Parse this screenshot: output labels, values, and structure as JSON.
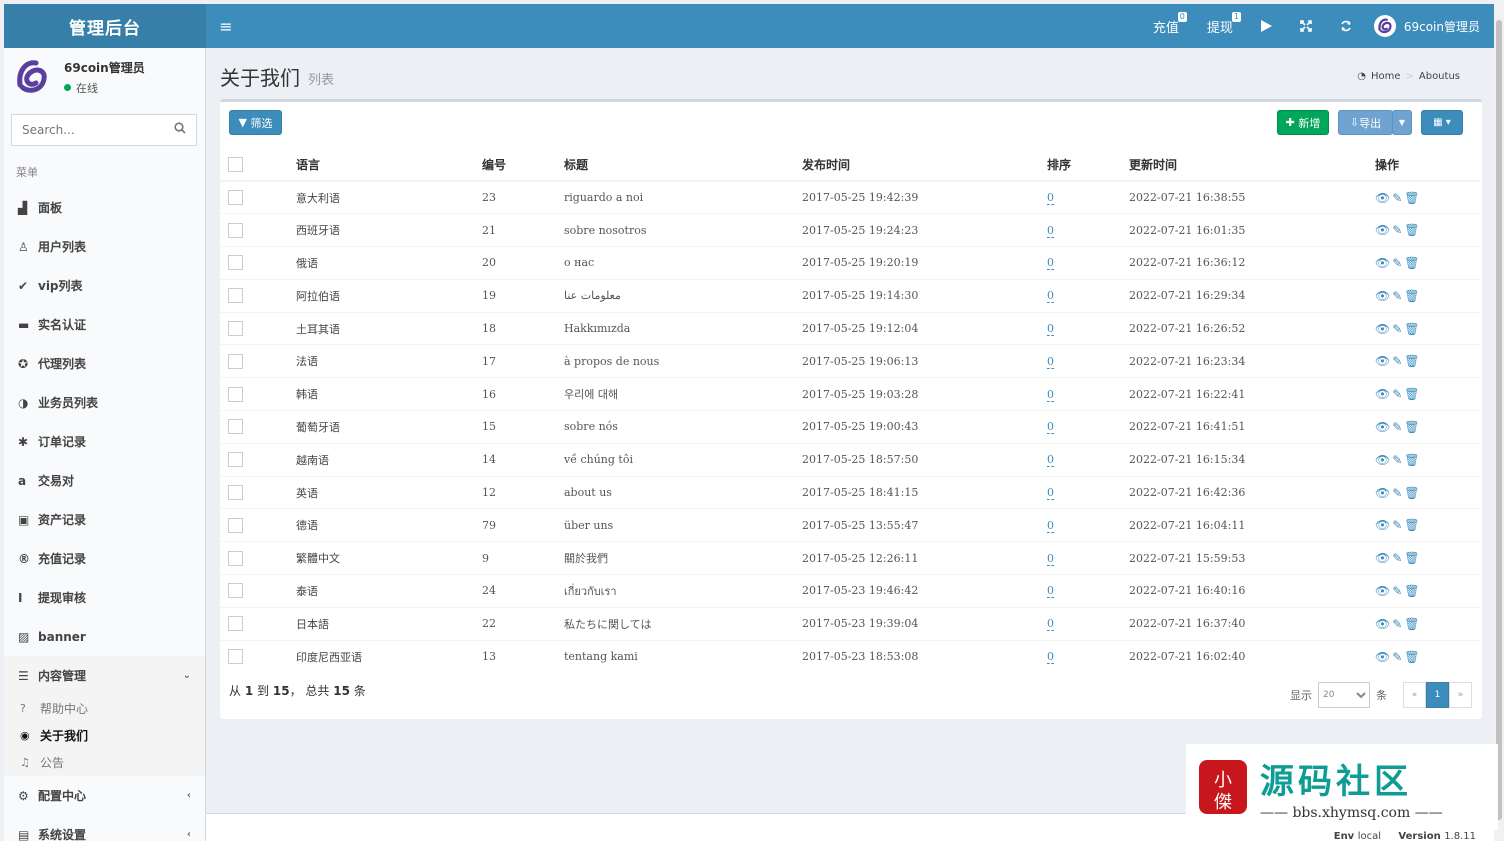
{
  "header": {
    "logo": "管理后台",
    "toggle_icon": "≡",
    "recharge_label": "充值",
    "recharge_badge": "0",
    "withdraw_label": "提现",
    "withdraw_badge": "1",
    "user_name": "69coin管理员"
  },
  "sidebar": {
    "user_name": "69coin管理员",
    "status": "在线",
    "search_placeholder": "Search...",
    "menu_header": "菜单",
    "items": [
      {
        "label": "面板",
        "icon": "▟"
      },
      {
        "label": "用户列表",
        "icon": "♙"
      },
      {
        "label": "vip列表",
        "icon": "✔"
      },
      {
        "label": "实名认证",
        "icon": "▬"
      },
      {
        "label": "代理列表",
        "icon": "✪"
      },
      {
        "label": "业务员列表",
        "icon": "◑"
      },
      {
        "label": "订单记录",
        "icon": "✱"
      },
      {
        "label": "交易对",
        "icon": "a"
      },
      {
        "label": "资产记录",
        "icon": "▣"
      },
      {
        "label": "充值记录",
        "icon": "®"
      },
      {
        "label": "提现审核",
        "icon": "I"
      },
      {
        "label": "banner",
        "icon": "▨"
      }
    ],
    "content_menu": {
      "label": "内容管理",
      "icon": "☰",
      "children": [
        {
          "label": "帮助中心",
          "icon": "?"
        },
        {
          "label": "关于我们",
          "icon": "◉"
        },
        {
          "label": "公告",
          "icon": "♫"
        }
      ]
    },
    "config_menu": {
      "label": "配置中心",
      "icon": "⚙"
    },
    "system_menu": {
      "label": "系统设置",
      "icon": "▤"
    }
  },
  "content": {
    "title": "关于我们",
    "subtitle": "列表",
    "breadcrumb_home": "Home",
    "breadcrumb_current": "Aboutus"
  },
  "toolbar": {
    "filter_label": "筛选",
    "new_label": "新增",
    "export_label": "导出"
  },
  "table": {
    "columns": [
      "语言",
      "编号",
      "标题",
      "发布时间",
      "排序",
      "更新时间",
      "操作"
    ],
    "rows": [
      {
        "lang": "意大利语",
        "id": "23",
        "title": "riguardo a noi",
        "published": "2017-05-25 19:42:39",
        "sort": "0",
        "updated": "2022-07-21 16:38:55"
      },
      {
        "lang": "西班牙语",
        "id": "21",
        "title": "sobre nosotros",
        "published": "2017-05-25 19:24:23",
        "sort": "0",
        "updated": "2022-07-21 16:01:35"
      },
      {
        "lang": "俄语",
        "id": "20",
        "title": "о нас",
        "published": "2017-05-25 19:20:19",
        "sort": "0",
        "updated": "2022-07-21 16:36:12"
      },
      {
        "lang": "阿拉伯语",
        "id": "19",
        "title": "معلومات عنا",
        "published": "2017-05-25 19:14:30",
        "sort": "0",
        "updated": "2022-07-21 16:29:34"
      },
      {
        "lang": "土耳其语",
        "id": "18",
        "title": "Hakkımızda",
        "published": "2017-05-25 19:12:04",
        "sort": "0",
        "updated": "2022-07-21 16:26:52"
      },
      {
        "lang": "法语",
        "id": "17",
        "title": "à propos de nous",
        "published": "2017-05-25 19:06:13",
        "sort": "0",
        "updated": "2022-07-21 16:23:34"
      },
      {
        "lang": "韩语",
        "id": "16",
        "title": "우리에 대해",
        "published": "2017-05-25 19:03:28",
        "sort": "0",
        "updated": "2022-07-21 16:22:41"
      },
      {
        "lang": "葡萄牙语",
        "id": "15",
        "title": "sobre nós",
        "published": "2017-05-25 19:00:43",
        "sort": "0",
        "updated": "2022-07-21 16:41:51"
      },
      {
        "lang": "越南语",
        "id": "14",
        "title": "về chúng tôi",
        "published": "2017-05-25 18:57:50",
        "sort": "0",
        "updated": "2022-07-21 16:15:34"
      },
      {
        "lang": "英语",
        "id": "12",
        "title": "about us",
        "published": "2017-05-25 18:41:15",
        "sort": "0",
        "updated": "2022-07-21 16:42:36"
      },
      {
        "lang": "德语",
        "id": "79",
        "title": "über uns",
        "published": "2017-05-25 13:55:47",
        "sort": "0",
        "updated": "2022-07-21 16:04:11"
      },
      {
        "lang": "繁體中文",
        "id": "9",
        "title": "關於我們",
        "published": "2017-05-25 12:26:11",
        "sort": "0",
        "updated": "2022-07-21 15:59:53"
      },
      {
        "lang": "泰语",
        "id": "24",
        "title": "เกี่ยวกับเรา",
        "published": "2017-05-23 19:46:42",
        "sort": "0",
        "updated": "2022-07-21 16:40:16"
      },
      {
        "lang": "日本語",
        "id": "22",
        "title": "私たちに関しては",
        "published": "2017-05-23 19:39:04",
        "sort": "0",
        "updated": "2022-07-21 16:37:40"
      },
      {
        "lang": "印度尼西亚语",
        "id": "13",
        "title": "tentang kami",
        "published": "2017-05-23 18:53:08",
        "sort": "0",
        "updated": "2022-07-21 16:02:40"
      }
    ]
  },
  "summary": {
    "from_label": "从",
    "from": "1",
    "to_label": "到",
    "to": "15",
    "total_label": "， 总共",
    "total": "15",
    "unit": "条"
  },
  "pagination": {
    "show_label": "显示",
    "page_size": "20",
    "unit": "条",
    "prev": "«",
    "current": "1",
    "next": "»"
  },
  "footer": {
    "env_label": "Env",
    "env": "local",
    "version_label": "Version",
    "version": "1.8.11"
  },
  "watermark": {
    "seal": "小傑",
    "title": "源码社区",
    "url": "bbs.xhymsq.com"
  },
  "colors": {
    "primary": "#3c8dbc",
    "success": "#00a65a",
    "sidebar_bg": "#f9fafc"
  }
}
